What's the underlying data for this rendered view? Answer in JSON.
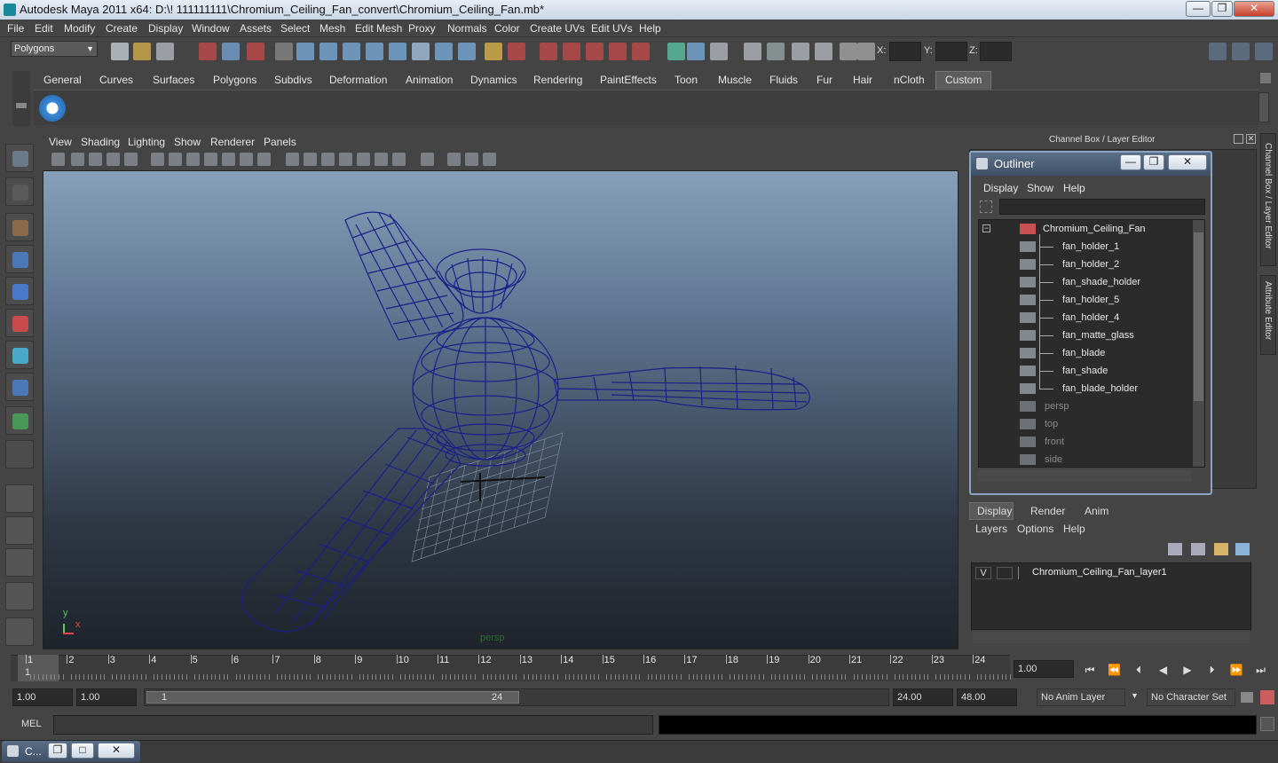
{
  "window": {
    "title": "Autodesk Maya 2011 x64: D:\\! 111111111\\Chromium_Ceiling_Fan_convert\\Chromium_Ceiling_Fan.mb*",
    "min_label": "—",
    "max_label": "❐",
    "close_label": "✕"
  },
  "menubar": [
    "File",
    "Edit",
    "Modify",
    "Create",
    "Display",
    "Window",
    "Assets",
    "Select",
    "Mesh",
    "Edit Mesh",
    "Proxy",
    "Normals",
    "Color",
    "Create UVs",
    "Edit UVs",
    "Help"
  ],
  "statusline": {
    "mode": "Polygons",
    "x_label": "X:",
    "y_label": "Y:",
    "z_label": "Z:"
  },
  "shelf": {
    "tabs": [
      "General",
      "Curves",
      "Surfaces",
      "Polygons",
      "Subdivs",
      "Deformation",
      "Animation",
      "Dynamics",
      "Rendering",
      "PaintEffects",
      "Toon",
      "Muscle",
      "Fluids",
      "Fur",
      "Hair",
      "nCloth",
      "Custom"
    ],
    "active_tab": "Custom"
  },
  "panel": {
    "menus": [
      "View",
      "Shading",
      "Lighting",
      "Show",
      "Renderer",
      "Panels"
    ],
    "camera_label": "persp",
    "axis_x": "x",
    "axis_y": "y"
  },
  "channel_box": {
    "title": "Channel Box / Layer Editor",
    "side_tab_1": "Channel Box / Layer Editor",
    "side_tab_2": "Attribute Editor"
  },
  "outliner": {
    "title": "Outliner",
    "menus": [
      "Display",
      "Show",
      "Help"
    ],
    "root": "Chromium_Ceiling_Fan",
    "children": [
      "fan_holder_1",
      "fan_holder_2",
      "fan_shade_holder",
      "fan_holder_5",
      "fan_holder_4",
      "fan_matte_glass",
      "fan_blade",
      "fan_shade",
      "fan_blade_holder"
    ],
    "cameras": [
      "persp",
      "top",
      "front",
      "side"
    ]
  },
  "layer_editor": {
    "tabs": [
      "Display",
      "Render",
      "Anim"
    ],
    "active_tab": "Display",
    "menus": [
      "Layers",
      "Options",
      "Help"
    ],
    "layers": [
      {
        "visible": "V",
        "name": "Chromium_Ceiling_Fan_layer1"
      }
    ]
  },
  "time_slider": {
    "ticks": [
      "1",
      "2",
      "3",
      "4",
      "5",
      "6",
      "7",
      "8",
      "9",
      "10",
      "11",
      "12",
      "13",
      "14",
      "15",
      "16",
      "17",
      "18",
      "19",
      "20",
      "21",
      "22",
      "23",
      "24"
    ],
    "current_frame": "1",
    "current_time_field": "1.00"
  },
  "range_slider": {
    "start_time": "1.00",
    "playback_start": "1.00",
    "range_start_label": "1",
    "range_end_label": "24",
    "playback_end": "24.00",
    "end_time": "48.00",
    "anim_layer": "No Anim Layer",
    "character_set": "No Character Set"
  },
  "command_line": {
    "label": "MEL"
  },
  "taskbar": {
    "item_label": "C..."
  }
}
